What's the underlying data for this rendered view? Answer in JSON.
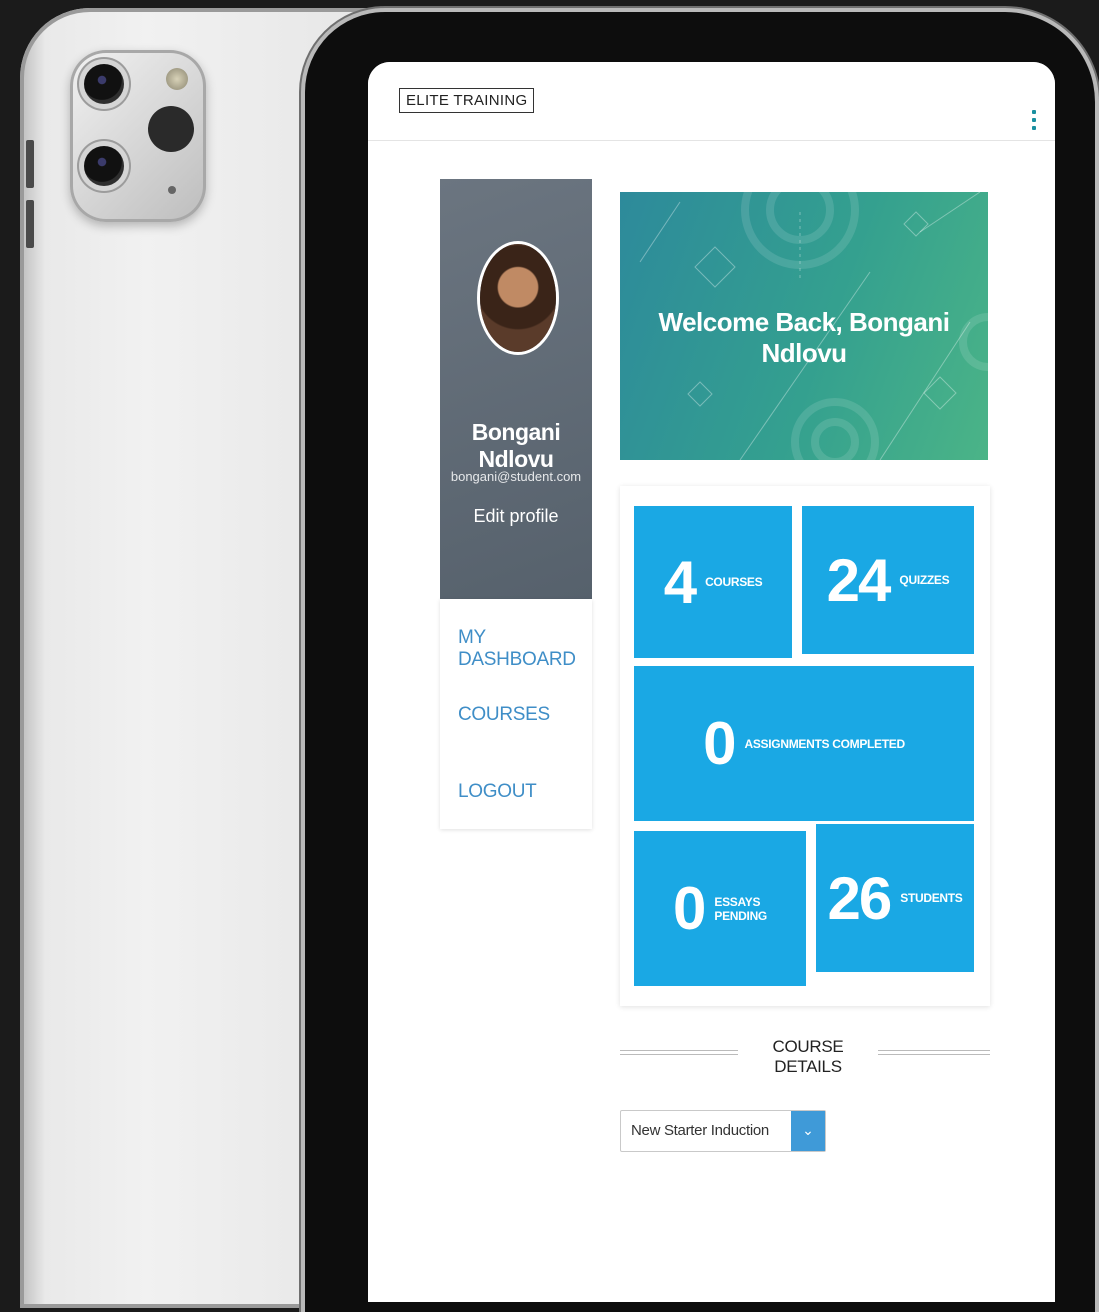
{
  "app": {
    "logo_text": "ELITE TRAINING"
  },
  "profile": {
    "name": "Bongani Ndlovu",
    "email": "bongani@student.com",
    "edit_label": "Edit profile"
  },
  "nav": {
    "items": [
      {
        "label": "MY DASHBOARD"
      },
      {
        "label": "COURSES"
      },
      {
        "label": "LOGOUT"
      }
    ]
  },
  "banner": {
    "welcome_text": "Welcome Back, Bongani Ndlovu"
  },
  "stats": {
    "courses": {
      "value": "4",
      "label": "COURSES"
    },
    "quizzes": {
      "value": "24",
      "label": "QUIZZES"
    },
    "assignments": {
      "value": "0",
      "label": "ASSIGNMENTS COMPLETED"
    },
    "essays": {
      "value": "0",
      "label_line1": "ESSAYS",
      "label_line2": "PENDING"
    },
    "students": {
      "value": "26",
      "label": "STUDENTS"
    }
  },
  "course_details": {
    "title": "COURSE DETAILS",
    "selected_course": "New Starter Induction"
  },
  "colors": {
    "tile_blue": "#1aa8e4",
    "nav_link_blue": "#3f8ec7",
    "banner_teal": "#2d8a9b",
    "profile_gray": "#5f6a75"
  },
  "icons": {
    "menu": "kebab-menu-icon",
    "dropdown": "chevron-down-icon"
  }
}
